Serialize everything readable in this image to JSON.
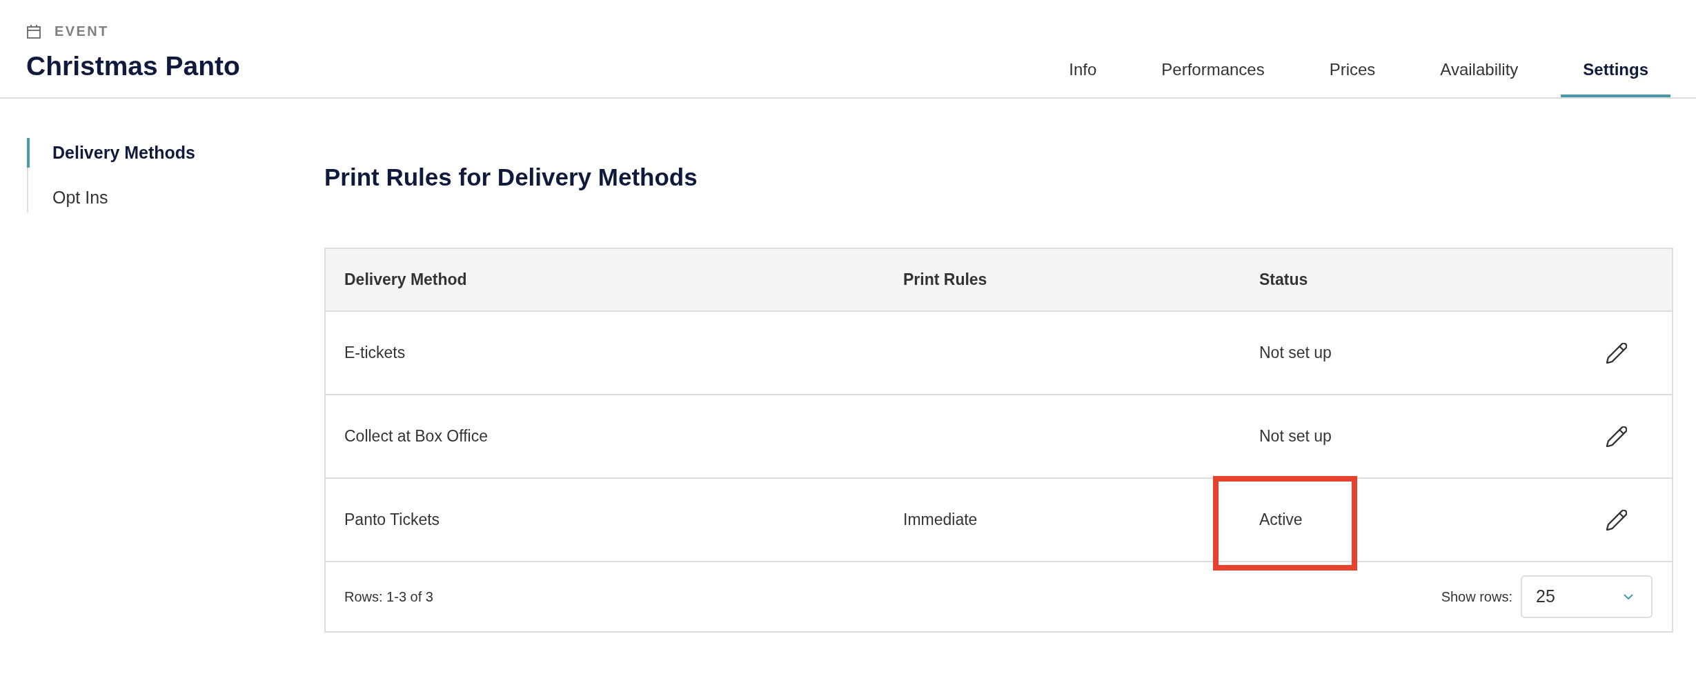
{
  "header": {
    "label": "EVENT",
    "title": "Christmas Panto"
  },
  "tabs": [
    {
      "label": "Info",
      "selected": false
    },
    {
      "label": "Performances",
      "selected": false
    },
    {
      "label": "Prices",
      "selected": false
    },
    {
      "label": "Availability",
      "selected": false
    },
    {
      "label": "Settings",
      "selected": true
    }
  ],
  "sidebar": {
    "items": [
      {
        "label": "Delivery Methods",
        "selected": true
      },
      {
        "label": "Opt Ins",
        "selected": false
      }
    ]
  },
  "section_title": "Print Rules for Delivery Methods",
  "table": {
    "columns": [
      "Delivery Method",
      "Print Rules",
      "Status"
    ],
    "rows": [
      {
        "delivery_method": "E-tickets",
        "status": "Not set up",
        "highlighted": false
      },
      {
        "delivery_method": "Collect at Box Office",
        "status": "Not set up",
        "highlighted": false
      },
      {
        "delivery_method": "Panto Tickets",
        "print_rules": "Immediate",
        "status": "Active",
        "highlighted": true
      }
    ],
    "footer": {
      "rows_info": "Rows: 1-3 of 3",
      "show_rows_label": "Show rows:",
      "show_rows_value": "25"
    }
  }
}
